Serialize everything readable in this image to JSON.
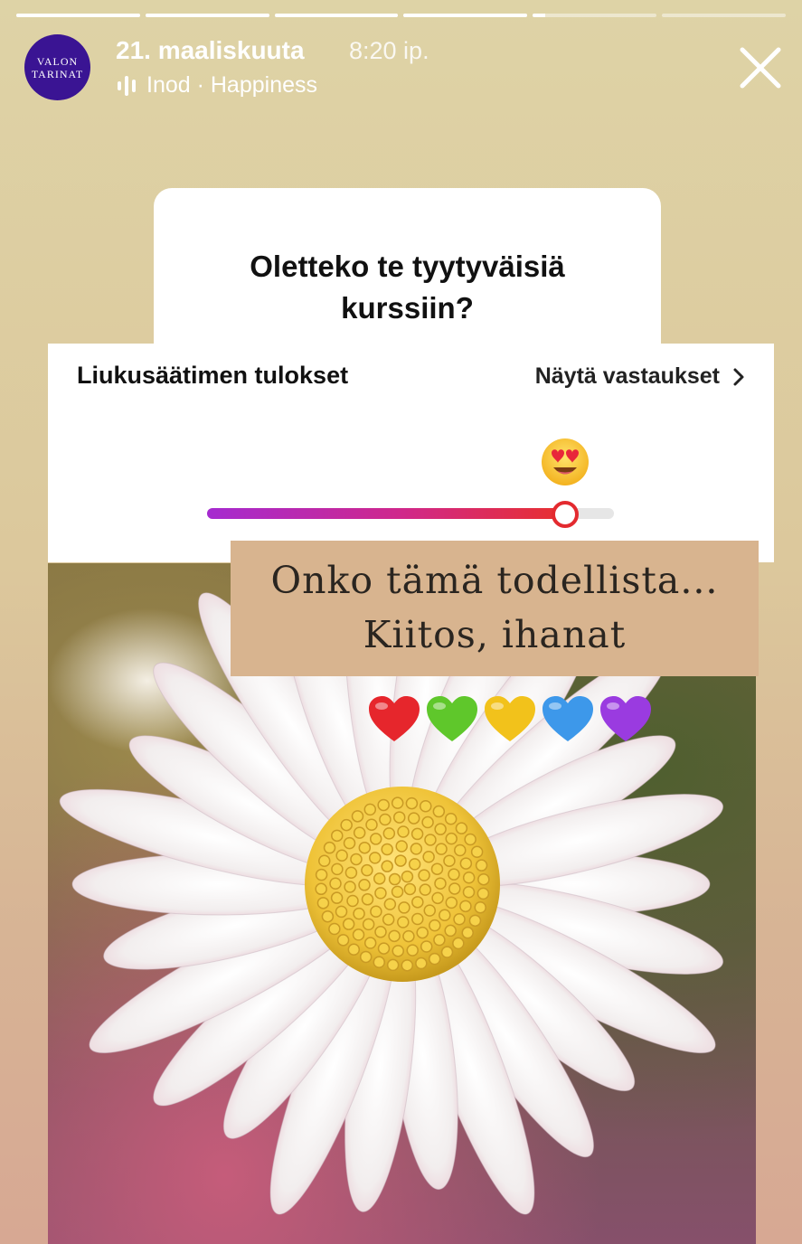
{
  "story": {
    "progress": [
      1,
      1,
      1,
      1,
      0.1,
      0
    ]
  },
  "header": {
    "avatar_line1": "VALON",
    "avatar_line2": "TARINAT",
    "date": "21. maaliskuuta",
    "time": "8:20 ip.",
    "music": "Inod · Happiness",
    "close_icon": "close-icon",
    "music_icon": "audio-wave-icon"
  },
  "question": {
    "text_line1": "Oletteko te tyytyväisiä",
    "text_line2": "kurssiin?"
  },
  "results": {
    "title": "Liukusäätimen tulokset",
    "link": "Näytä vastaukset",
    "link_icon": "chevron-right-icon",
    "emoji": "heart-eyes-emoji",
    "slider_value": 0.88,
    "colors": {
      "start": "#a52ad0",
      "end": "#e8302e"
    }
  },
  "caption": {
    "line1": "Onko tämä todellista...",
    "line2": "Kiitos, ihanat"
  },
  "hearts": [
    {
      "icon": "red-heart-icon",
      "color": "#e6262c"
    },
    {
      "icon": "green-heart-icon",
      "color": "#5fc72b"
    },
    {
      "icon": "yellow-heart-icon",
      "color": "#f2c21b"
    },
    {
      "icon": "blue-heart-icon",
      "color": "#3d98ea"
    },
    {
      "icon": "purple-heart-icon",
      "color": "#9a3be0"
    }
  ]
}
